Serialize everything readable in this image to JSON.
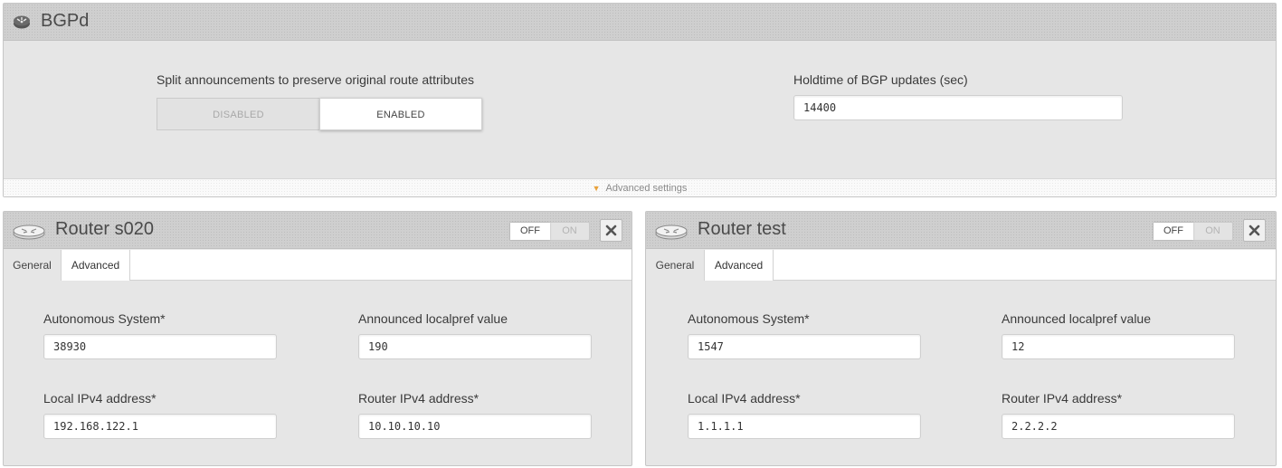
{
  "bgpd": {
    "title": "BGPd",
    "icon": "router-icon",
    "split_label": "Split announcements to preserve original route attributes",
    "split_options": {
      "disabled": "DISABLED",
      "enabled": "ENABLED",
      "selected": "ENABLED"
    },
    "holdtime_label": "Holdtime of BGP updates (sec)",
    "holdtime_value": "14400",
    "advanced_label": "Advanced settings"
  },
  "routers": [
    {
      "title": "Router s020",
      "toggle": {
        "off": "OFF",
        "on": "ON",
        "state": "OFF"
      },
      "tabs": {
        "general": "General",
        "advanced": "Advanced",
        "active": "General"
      },
      "as_label": "Autonomous System*",
      "as_value": "38930",
      "localpref_label": "Announced localpref value",
      "localpref_value": "190",
      "local_ip_label": "Local IPv4 address*",
      "local_ip_value": "192.168.122.1",
      "router_ip_label": "Router IPv4 address*",
      "router_ip_value": "10.10.10.10"
    },
    {
      "title": "Router test",
      "toggle": {
        "off": "OFF",
        "on": "ON",
        "state": "OFF"
      },
      "tabs": {
        "general": "General",
        "advanced": "Advanced",
        "active": "General"
      },
      "as_label": "Autonomous System*",
      "as_value": "1547",
      "localpref_label": "Announced localpref value",
      "localpref_value": "12",
      "local_ip_label": "Local IPv4 address*",
      "local_ip_value": "1.1.1.1",
      "router_ip_label": "Router IPv4 address*",
      "router_ip_value": "2.2.2.2"
    }
  ],
  "colors": {
    "panel_bg": "#e6e6e6",
    "header_bg": "#cfcfcf",
    "accent_triangle": "#e8a13a"
  }
}
